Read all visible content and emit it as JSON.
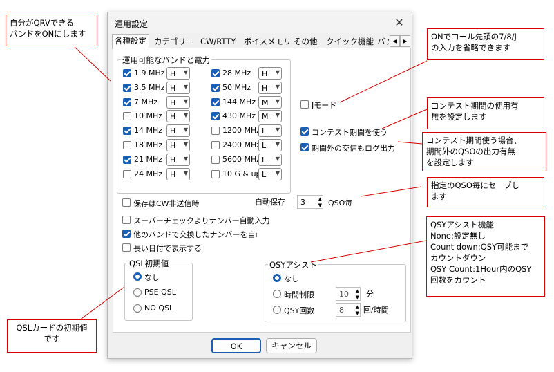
{
  "dialog": {
    "title": "運用設定",
    "close_glyph": "✕",
    "tabs": [
      "各種設定",
      "カテゴリー",
      "CW/RTTY",
      "ボイスメモリ",
      "その他",
      "クイック機能",
      "バン"
    ],
    "active_tab": 0
  },
  "bands_group": {
    "legend": "運用可能なバンドと電力",
    "left": [
      {
        "label": "1.9 MHz",
        "checked": true,
        "power": "H"
      },
      {
        "label": "3.5 MHz",
        "checked": true,
        "power": "H"
      },
      {
        "label": "7 MHz",
        "checked": true,
        "power": "H"
      },
      {
        "label": "10 MHz",
        "checked": false,
        "power": "H"
      },
      {
        "label": "14 MHz",
        "checked": true,
        "power": "H"
      },
      {
        "label": "18 MHz",
        "checked": false,
        "power": "H"
      },
      {
        "label": "21 MHz",
        "checked": true,
        "power": "H"
      },
      {
        "label": "24 MHz",
        "checked": false,
        "power": "H"
      }
    ],
    "right": [
      {
        "label": "28 MHz",
        "checked": true,
        "power": "H"
      },
      {
        "label": "50 MHz",
        "checked": true,
        "power": "H"
      },
      {
        "label": "144 MHz",
        "checked": true,
        "power": "M"
      },
      {
        "label": "430 MHz",
        "checked": true,
        "power": "M"
      },
      {
        "label": "1200 MHz",
        "checked": false,
        "power": "L"
      },
      {
        "label": "2400 MHz",
        "checked": false,
        "power": "L"
      },
      {
        "label": "5600 MHz",
        "checked": false,
        "power": "L"
      },
      {
        "label": "10 G & up",
        "checked": false,
        "power": "L"
      }
    ]
  },
  "options": {
    "j_mode": {
      "label": "Jモード",
      "checked": false
    },
    "use_contest_period": {
      "label": "コンテスト期間を使う",
      "checked": true
    },
    "log_outside_period": {
      "label": "期間外の交信もログ出力",
      "checked": true
    },
    "no_save_cw": {
      "label": "保存はCW非送信時",
      "checked": false
    },
    "auto_save_label": "自動保存",
    "auto_save_value": "3",
    "auto_save_unit": "QSO毎",
    "super_check": {
      "label": "スーパーチェックよりナンバー自動入力",
      "checked": false
    },
    "other_band_number": {
      "label": "他のバンドで交換したナンバーを自i",
      "checked": true
    },
    "long_date": {
      "label": "長い日付で表示する",
      "checked": false
    }
  },
  "qsl_group": {
    "legend": "QSL初期値",
    "items": [
      {
        "label": "なし",
        "selected": true
      },
      {
        "label": "PSE QSL",
        "selected": false
      },
      {
        "label": "NO QSL",
        "selected": false
      }
    ]
  },
  "qsy_group": {
    "legend": "QSYアシスト",
    "none": {
      "label": "なし",
      "selected": true
    },
    "time_limit": {
      "label": "時間制限",
      "selected": false,
      "value": "10",
      "unit": "分"
    },
    "qsy_count": {
      "label": "QSY回数",
      "selected": false,
      "value": "8",
      "unit": "回/時間"
    }
  },
  "buttons": {
    "ok": "OK",
    "cancel": "キャンセル"
  },
  "callouts": {
    "qrv_bands": [
      "自分がQRVできる",
      "バンドをONにします"
    ],
    "j_mode": [
      "ONでコール先頭の7/8/J",
      "の入力を省略できます"
    ],
    "contest_period": [
      "コンテスト期間の使用有",
      "無を設定します"
    ],
    "outside_period": [
      "コンテスト期間使う場合、",
      "期間外のQSOの出力有無",
      "を設定します"
    ],
    "auto_save": [
      "指定のQSO毎にセーブし",
      "ます"
    ],
    "qsy_assist": [
      "QSYアシスト機能",
      "None:設定無し",
      "Count down:QSY可能まで",
      "カウントダウン",
      "QSY Count:1Hour内のQSY",
      "回数をカウント"
    ],
    "qsl": [
      "QSLカードの初期値",
      "です"
    ]
  },
  "colors": {
    "accent": "#1a5fb4",
    "callout_border": "#d80000"
  }
}
